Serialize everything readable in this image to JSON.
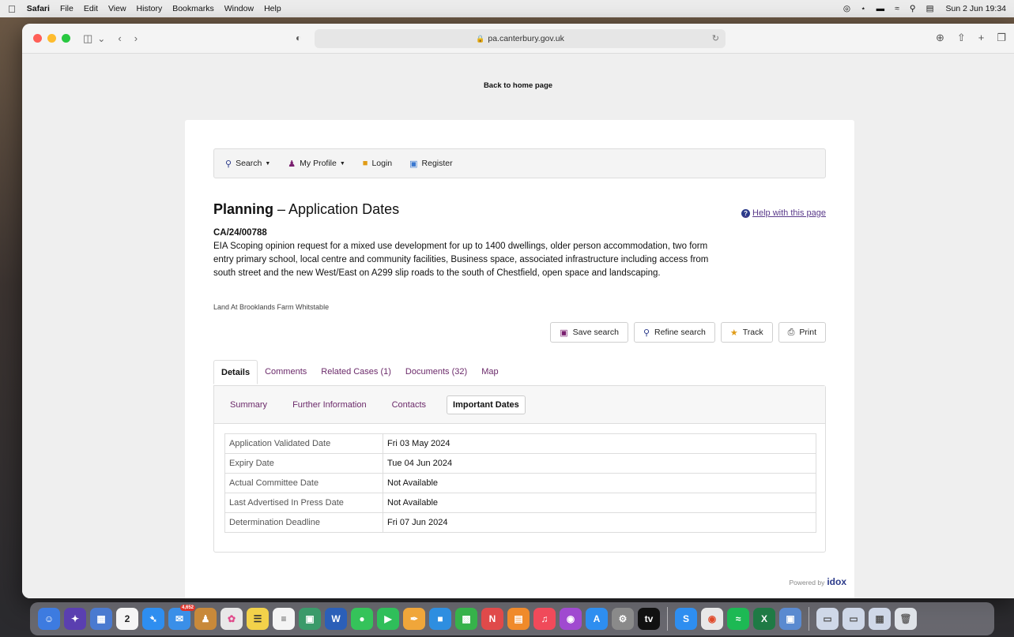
{
  "menubar": {
    "apple": "",
    "app_name": "Safari",
    "items": [
      "File",
      "Edit",
      "View",
      "History",
      "Bookmarks",
      "Window",
      "Help"
    ],
    "clock": "Sun 2 Jun 19:34"
  },
  "browser": {
    "url": "pa.canterbury.gov.uk"
  },
  "page": {
    "back_link": "Back to home page",
    "nav": {
      "search": "Search",
      "my_profile": "My Profile",
      "login": "Login",
      "register": "Register"
    },
    "title_bold": "Planning",
    "title_rest": " – Application Dates",
    "help_link": "Help with this page",
    "reference": "CA/24/00788",
    "description": "EIA Scoping opinion request for a mixed use development for up to 1400 dwellings, older person accommodation, two form entry primary school, local centre and community facilities, Business space, associated infrastructure including access from south street and the new West/East on A299 slip roads to the south of Chestfield, open space and landscaping.",
    "address": "Land At Brooklands Farm Whitstable",
    "actions": {
      "save": "Save search",
      "refine": "Refine search",
      "track": "Track",
      "print": "Print"
    },
    "tabs": [
      "Details",
      "Comments",
      "Related Cases (1)",
      "Documents (32)",
      "Map"
    ],
    "subtabs": [
      "Summary",
      "Further Information",
      "Contacts",
      "Important Dates"
    ],
    "dates": [
      {
        "label": "Application Validated Date",
        "value": "Fri 03 May 2024"
      },
      {
        "label": "Expiry Date",
        "value": "Tue 04 Jun 2024"
      },
      {
        "label": "Actual Committee Date",
        "value": "Not Available"
      },
      {
        "label": "Last Advertised In Press Date",
        "value": "Not Available"
      },
      {
        "label": "Determination Deadline",
        "value": "Fri 07 Jun 2024"
      }
    ],
    "powered_by": "Powered by",
    "powered_brand": "idox"
  },
  "dock": {
    "calendar_day": "2",
    "mail_badge": "4,652"
  }
}
